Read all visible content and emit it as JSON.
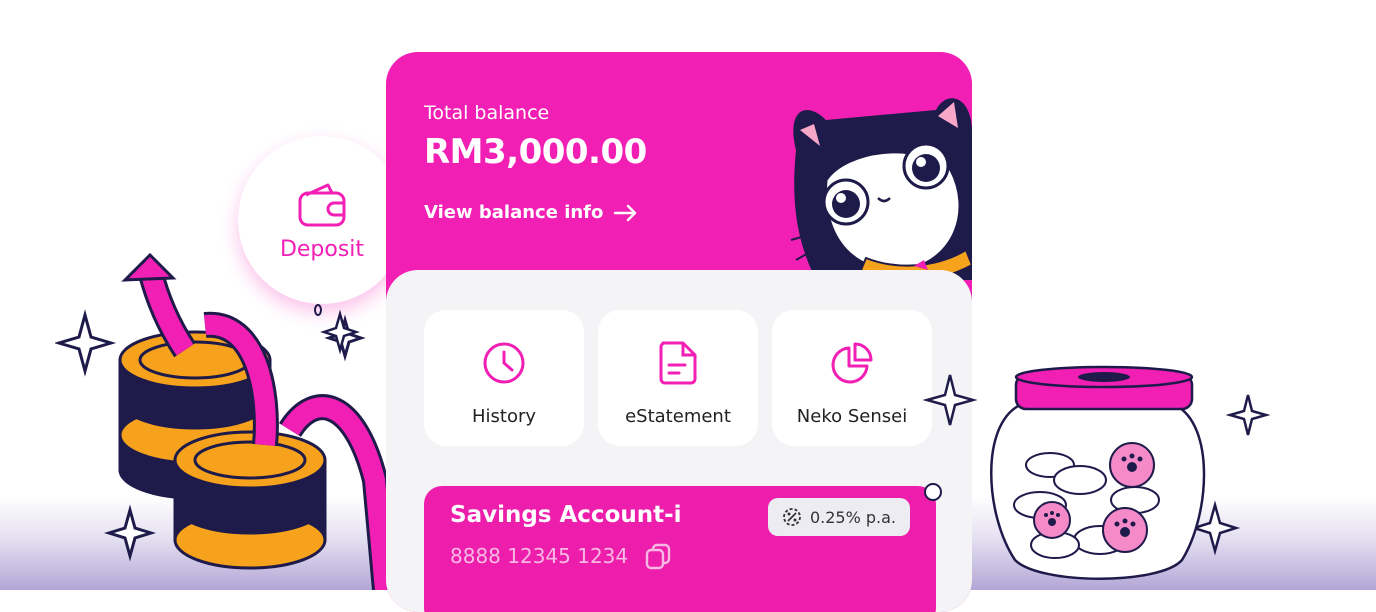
{
  "balance": {
    "label": "Total balance",
    "amount": "RM3,000.00",
    "view_link": "View balance info"
  },
  "deposit": {
    "label": "Deposit",
    "icon": "wallet-icon"
  },
  "quick_actions": [
    {
      "label": "History",
      "icon": "clock-icon"
    },
    {
      "label": "eStatement",
      "icon": "document-icon"
    },
    {
      "label": "Neko Sensei",
      "icon": "pie-chart-icon"
    }
  ],
  "account": {
    "name": "Savings Account-i",
    "number": "8888 12345 1234",
    "rate": "0.25% p.a."
  },
  "colors": {
    "brand": "#f21fb5",
    "panel": "#f4f4f6",
    "coin": "#f6a21c",
    "navy": "#1e1b4b"
  }
}
